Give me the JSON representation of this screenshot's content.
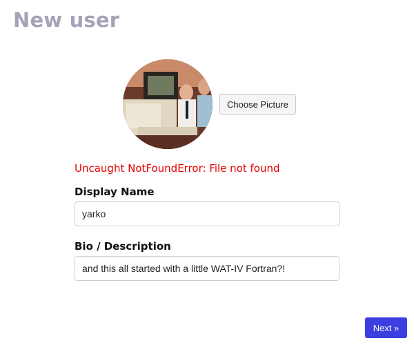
{
  "page": {
    "title": "New user"
  },
  "avatar": {
    "choose_label": "Choose Picture"
  },
  "error": {
    "message": "Uncaught NotFoundError: File not found"
  },
  "form": {
    "display_name": {
      "label": "Display Name",
      "value": "yarko"
    },
    "bio": {
      "label": "Bio / Description",
      "value": "and this all started with a little WAT-IV Fortran?!"
    }
  },
  "actions": {
    "next_label": "Next »"
  },
  "colors": {
    "title": "#a5a3b8",
    "error": "#e60000",
    "primary_button": "#3b3fe0"
  }
}
